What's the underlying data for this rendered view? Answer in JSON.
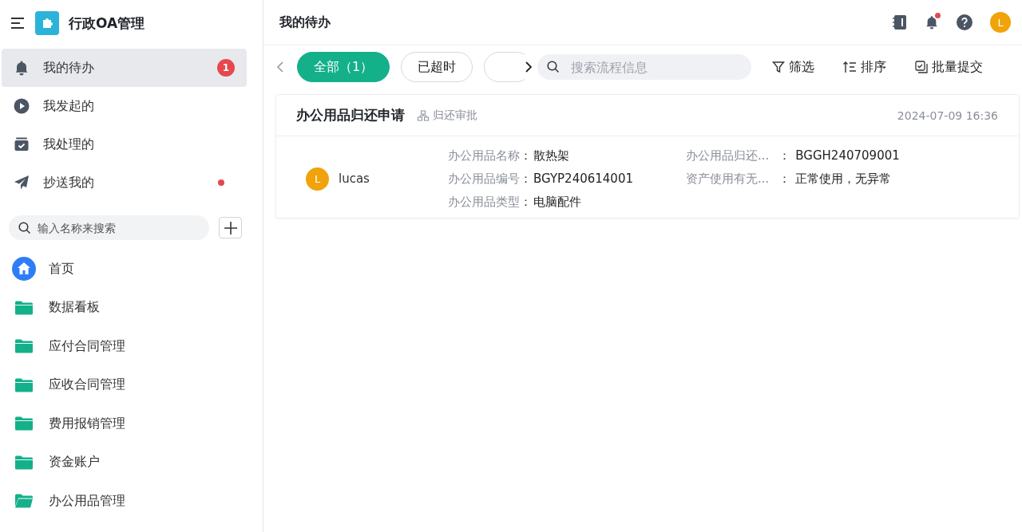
{
  "app": {
    "title": "行政OA管理"
  },
  "nav": [
    {
      "label": "我的待办",
      "kind": "bell",
      "selected": true,
      "badge": "1",
      "dot": false
    },
    {
      "label": "我发起的",
      "kind": "play",
      "selected": false,
      "dot": false
    },
    {
      "label": "我处理的",
      "kind": "check",
      "selected": false,
      "dot": false
    },
    {
      "label": "抄送我的",
      "kind": "send",
      "selected": false,
      "dot": true
    }
  ],
  "sidebar_search": {
    "placeholder": "输入名称来搜索"
  },
  "menu": [
    {
      "label": "首页",
      "kind": "home"
    },
    {
      "label": "数据看板",
      "kind": "folder",
      "expanded": false
    },
    {
      "label": "应付合同管理",
      "kind": "folder",
      "expanded": false
    },
    {
      "label": "应收合同管理",
      "kind": "folder",
      "expanded": false
    },
    {
      "label": "费用报销管理",
      "kind": "folder",
      "expanded": false
    },
    {
      "label": "资金账户",
      "kind": "folder",
      "expanded": false
    },
    {
      "label": "办公用品管理",
      "kind": "folder",
      "expanded": true
    }
  ],
  "header": {
    "title": "我的待办",
    "notification_dot": true,
    "avatar": "L"
  },
  "tabs": [
    {
      "label": "全部（1）",
      "selected": true
    },
    {
      "label": "已超时",
      "selected": false
    },
    {
      "selected": false
    }
  ],
  "search": {
    "placeholder": "搜索流程信息"
  },
  "actions": [
    {
      "label": "筛选",
      "kind": "filter"
    },
    {
      "label": "排序",
      "kind": "sort"
    },
    {
      "label": "批量提交",
      "kind": "batch"
    }
  ],
  "cards": [
    {
      "title": "办公用品归还申请",
      "tag": "归还审批",
      "time": "2024-07-09 16:36",
      "user": "lucas",
      "avatar": "L",
      "fields": [
        [
          {
            "label": "办公用品名称",
            "separator": "：",
            "value": "散热架"
          },
          {
            "label": "办公用品编号",
            "separator": "：",
            "value": "BGYP240614001"
          },
          {
            "label": "办公用品类型",
            "separator": "：",
            "value": "电脑配件"
          }
        ],
        [
          {
            "label": "办公用品归还...",
            "separator": "：",
            "value": "BGGH240709001"
          },
          {
            "label": "资产使用有无...",
            "separator": "：",
            "value": "正常使用，无异常"
          }
        ]
      ]
    }
  ]
}
